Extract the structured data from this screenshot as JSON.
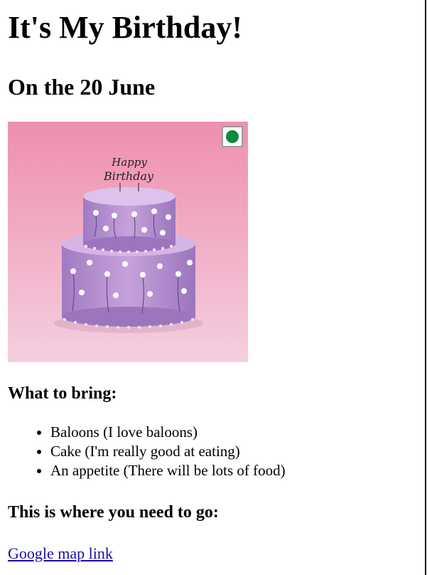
{
  "page": {
    "title": "It's My Birthday!",
    "subtitle": "On the 20 June"
  },
  "image": {
    "alt": "Two-tier lilac birthday cake with Happy Birthday topper",
    "topper_text": "Happy Birthday",
    "icon": "veg-indicator-icon",
    "colors": {
      "background_top": "#ee8fae",
      "background_bottom": "#f2c6d8",
      "cake": "#b98fd0",
      "cake_shadow": "#9a6fb8",
      "veg_dot": "#0a8a3a"
    }
  },
  "bring": {
    "heading": "What to bring:",
    "items": [
      "Baloons (I love baloons)",
      "Cake (I'm really good at eating)",
      "An appetite (There will be lots of food)"
    ]
  },
  "where": {
    "heading": "This is where you need to go:",
    "link_text": "Google map link"
  },
  "colors": {
    "link": "#1a0dab",
    "text": "#000000"
  }
}
